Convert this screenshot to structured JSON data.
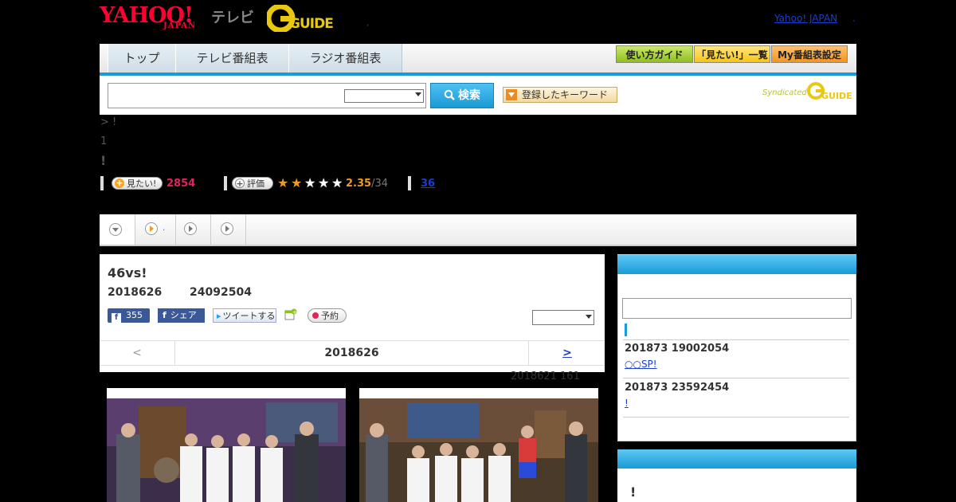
{
  "header": {
    "yahoo_logo": "YAHOO!",
    "yahoo_sub": "JAPAN",
    "tv_label": "テレビ",
    "gguide_logo": "G GUIDE",
    "link": "Yahoo! JAPAN",
    "dot": ".",
    "small_dot": ","
  },
  "nav": {
    "tabs": [
      "トップ",
      "テレビ番組表",
      "ラジオ番組表"
    ],
    "util_buttons": [
      "使い方ガイド",
      "「見たい!」一覧",
      "My番組表設定"
    ]
  },
  "search": {
    "button": "検索",
    "keyword_button": "登録したキーワード",
    "syndicated": "Syndicated",
    "syndicated_logo": "GUIDE"
  },
  "breadcrumb": "> !",
  "line2": "1",
  "line3": "!",
  "stats": {
    "want_label": "見たい!",
    "want_count": "2854",
    "rate_label": "評価",
    "rating": "2.35",
    "rating_count": "/34",
    "review_link": "36"
  },
  "tabs": {
    "tab2_suffix": "."
  },
  "program": {
    "title": "46vs!",
    "date": "2018626",
    "time": "24092504",
    "fb_count": "355",
    "fb_share": "シェア",
    "tweet": "ツイートする",
    "reserve": "予約",
    "prev": "<",
    "current": "2018626",
    "next": ">",
    "meta": "2018621  161"
  },
  "sidebar": {
    "row1_date": "201873  19002054",
    "row1_link": "○○SP!  ",
    "row2_date": "201873  23592454",
    "row2_link": "!  ",
    "box2_text": "!"
  },
  "colors": {
    "accent": "#1a9ad6",
    "want_count": "#e0245e",
    "rating": "#f39a1e",
    "link": "#1a3dcc"
  }
}
